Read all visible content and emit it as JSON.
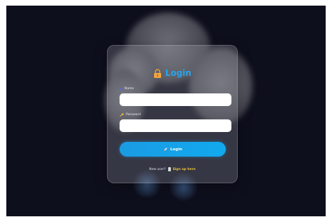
{
  "login": {
    "title": "Login",
    "name_label": "Name",
    "password_label": "Password",
    "name_value": "",
    "password_value": "",
    "submit_label": "Login",
    "signup_prompt": "New user?",
    "signup_link": "Sign up here"
  },
  "icons": {
    "title": "lock-icon",
    "name": "user-icon",
    "password": "key-icon",
    "submit": "rocket-icon",
    "signup": "document-icon"
  },
  "colors": {
    "background": "#0e0f1d",
    "accent": "#1a9be2",
    "title": "#27a6e8",
    "link": "#f2c23a"
  }
}
